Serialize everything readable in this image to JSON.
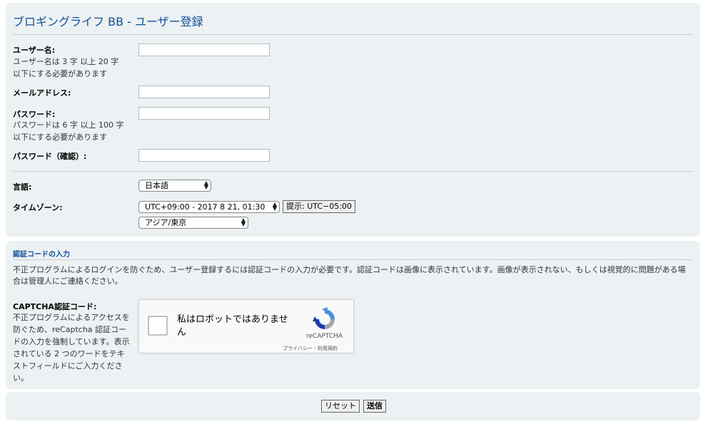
{
  "page_title": "ブロギングライフ BB - ユーザー登録",
  "form": {
    "username_label": "ユーザー名:",
    "username_help_1": "ユーザー名は 3 字 以上 20 字",
    "username_help_2": "以下にする必要があります",
    "username_value": "",
    "email_label": "メールアドレス:",
    "email_value": "",
    "password_label": "パスワード:",
    "password_help_1": "パスワードは 6 字 以上 100 字",
    "password_help_2": "以下にする必要があります",
    "password_value": "",
    "password_confirm_label": "パスワード（確認）:",
    "password_confirm_value": "",
    "language_label": "言語:",
    "language_selected": "日本語",
    "timezone_label": "タイムゾーン:",
    "timezone_selected": "UTC+09:00 - 2017 8 21, 01:30",
    "timezone_suggest_button": "提示: UTC−05:00",
    "timezone_region_selected": "アジア/東京"
  },
  "captcha_section": {
    "title": "認証コードの入力",
    "description": "不正プログラムによるログインを防ぐため、ユーザー登録するには認証コードの入力が必要です。認証コードは画像に表示されています。画像が表示されない、もしくは視覚的に問題がある場合は管理人にご連絡ください。",
    "code_label": "CAPTCHA認証コード:",
    "code_help": "不正プログラムによるアクセスを防ぐため、reCaptcha 認証コードの入力を強制しています。表示されている 2 つのワードをテキストフィールドにご入力ください。",
    "widget": {
      "checkbox_text": "私はロボットではありません",
      "brand": "reCAPTCHA",
      "links": "プライバシー - 利用規約"
    }
  },
  "actions": {
    "reset_label": "リセット",
    "submit_label": "送信"
  },
  "colors": {
    "panel_bg": "#ecf1f3",
    "title_blue": "#115098",
    "recaptcha_blue": "#4a90e2",
    "recaptcha_gray": "#a6a6a6"
  }
}
